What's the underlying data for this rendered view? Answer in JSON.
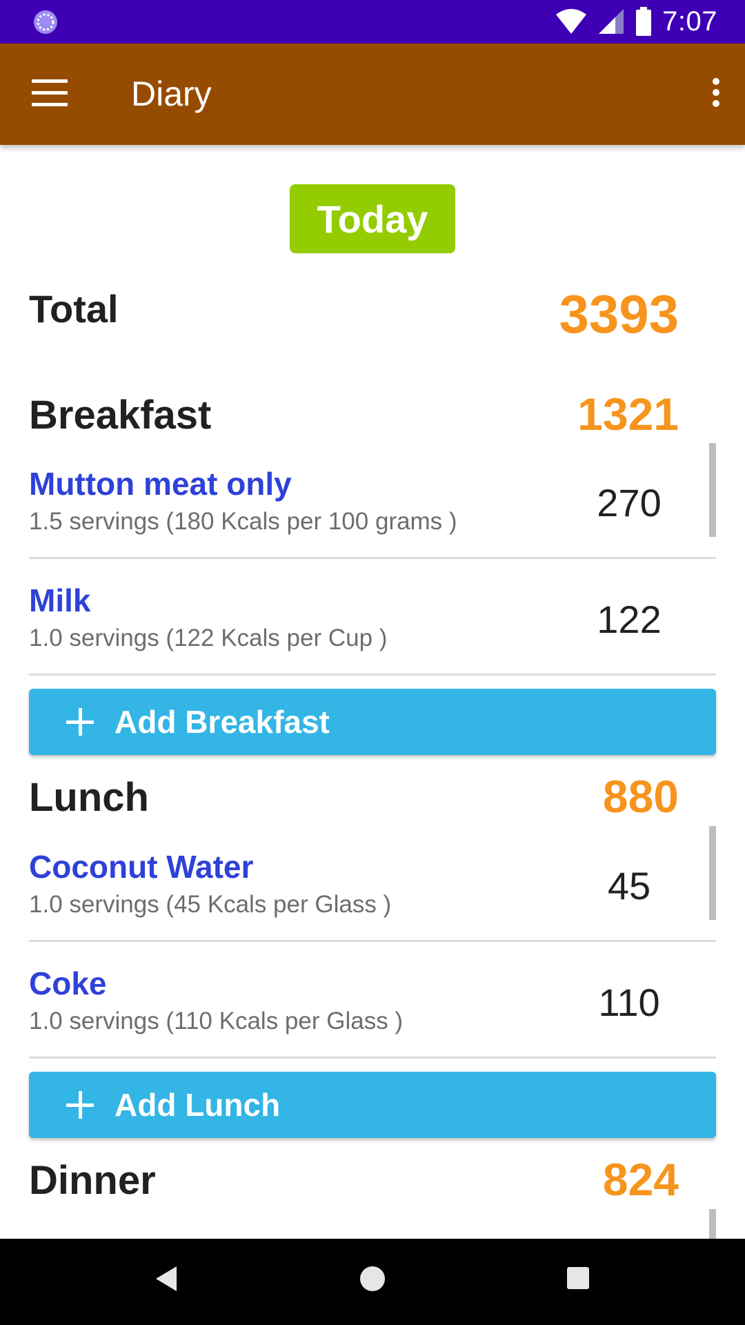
{
  "status_bar": {
    "time": "7:07"
  },
  "app_bar": {
    "title": "Diary"
  },
  "date_button": {
    "label": "Today"
  },
  "total": {
    "label": "Total",
    "value": "3393"
  },
  "breakfast": {
    "title": "Breakfast",
    "value": "1321",
    "items": [
      {
        "name": "Mutton meat only",
        "desc": "1.5 servings (180 Kcals per 100 grams )",
        "kcal": "270"
      },
      {
        "name": "Milk",
        "desc": "1.0 servings (122 Kcals per Cup )",
        "kcal": "122"
      }
    ],
    "add_label": "Add Breakfast"
  },
  "lunch": {
    "title": "Lunch",
    "value": "880",
    "items": [
      {
        "name": "Coconut Water",
        "desc": "1.0 servings (45 Kcals per Glass )",
        "kcal": "45"
      },
      {
        "name": "Coke",
        "desc": "1.0 servings (110 Kcals per Glass )",
        "kcal": "110"
      }
    ],
    "add_label": "Add Lunch"
  },
  "dinner": {
    "title": "Dinner",
    "value": "824"
  },
  "colors": {
    "status_bar": "#3f00b5",
    "app_bar": "#964c00",
    "today_button": "#93cc00",
    "calorie_accent": "#f7941d",
    "food_name": "#2e41d8",
    "add_button": "#33b5e5"
  }
}
